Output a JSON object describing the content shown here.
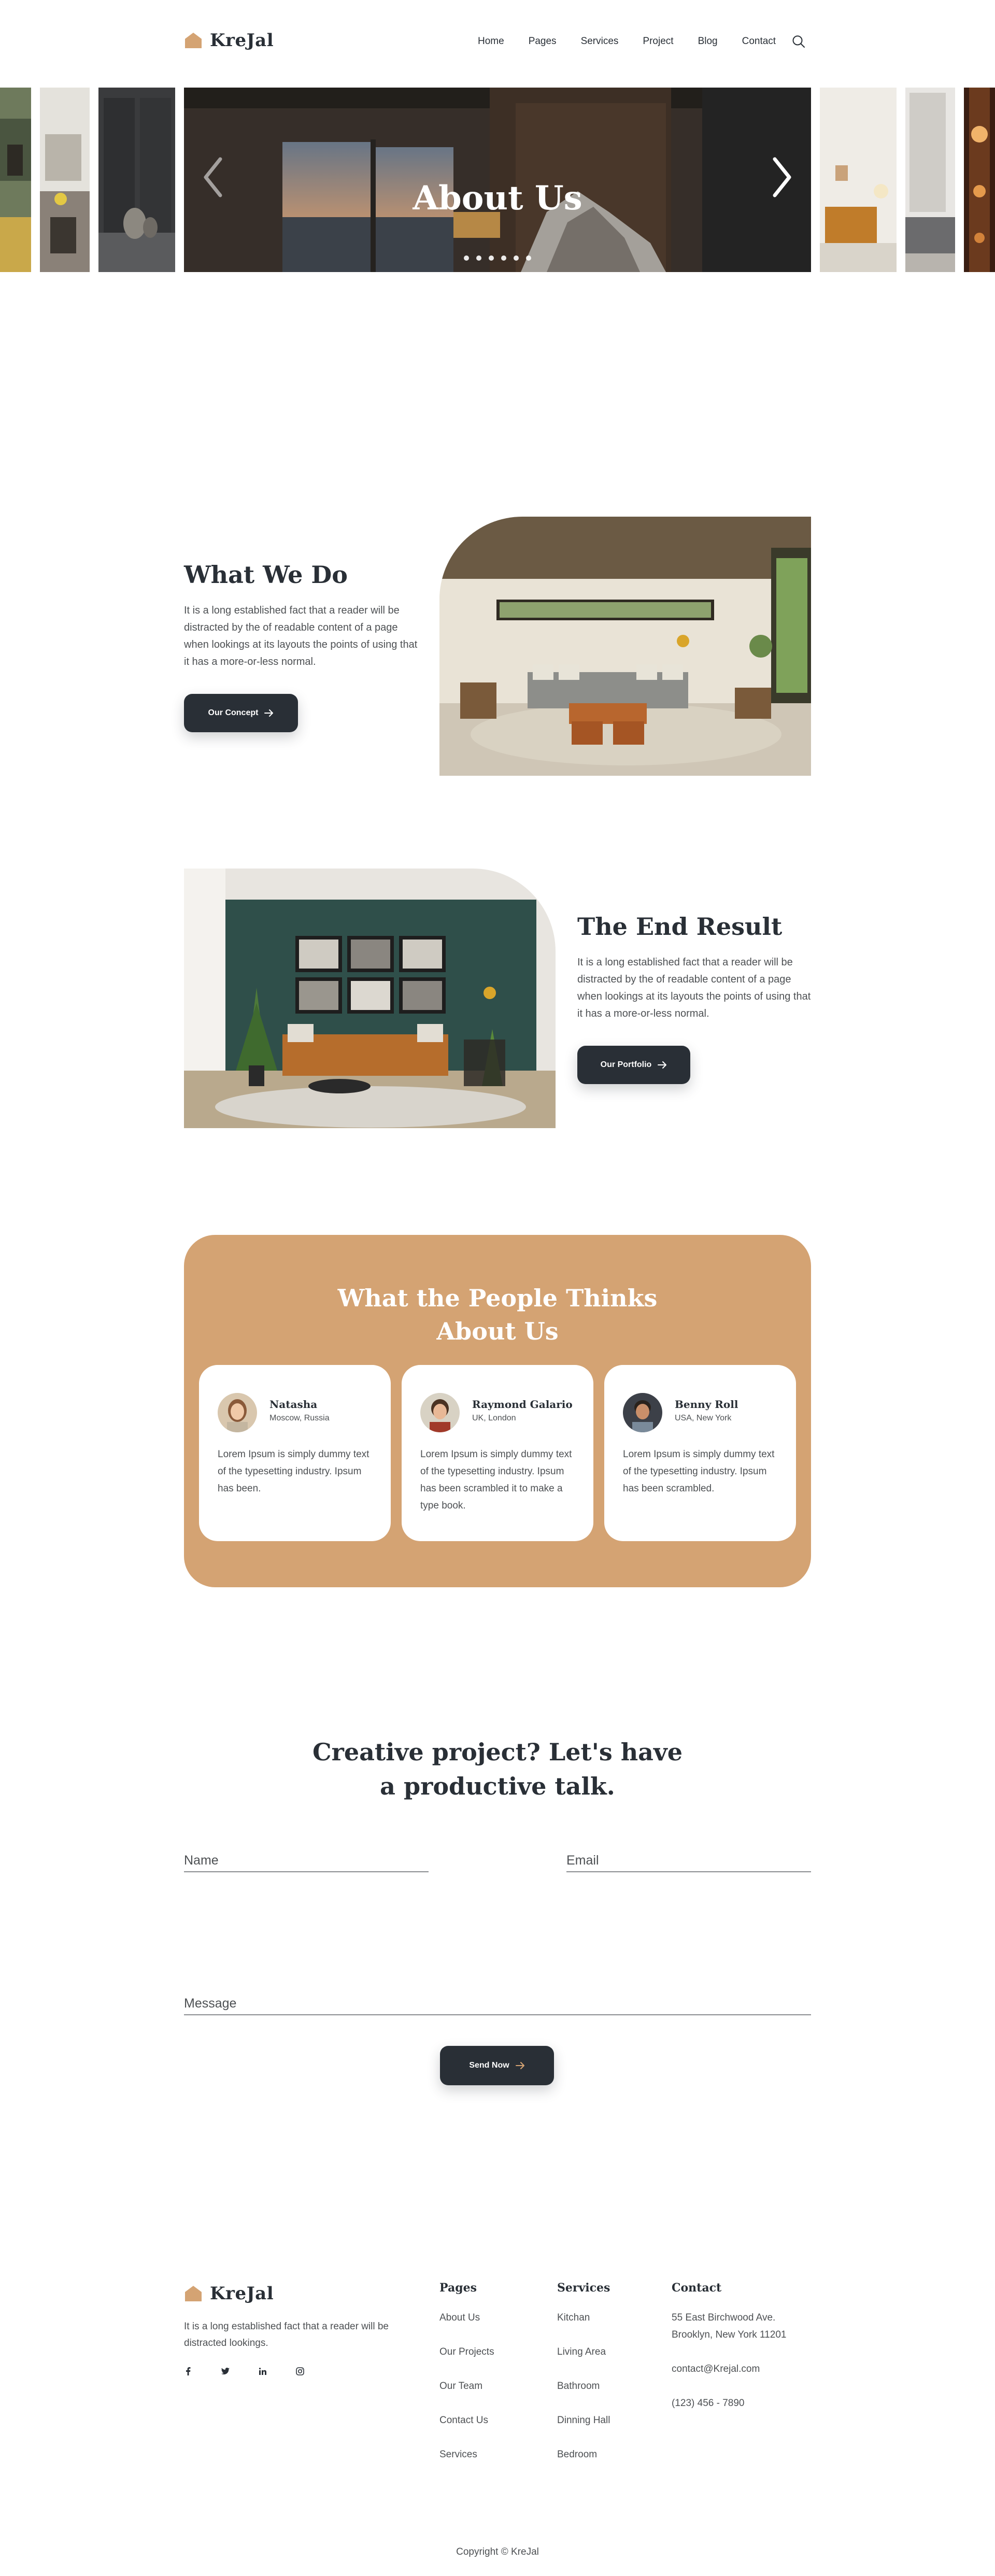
{
  "header": {
    "logo_text": "KreJal",
    "nav": [
      "Home",
      "Pages",
      "Services",
      "Project",
      "Blog",
      "Contact"
    ],
    "search_icon": "search-icon"
  },
  "slider": {
    "title": "About Us",
    "dot_count": 6,
    "prev_icon": "chevron-left-icon",
    "next_icon": "chevron-right-icon"
  },
  "what_we_do": {
    "title": "What We Do",
    "text": "It is a long established fact that a reader will be distracted by the of readable content of a page when lookings at its layouts the points of using that it has a more-or-less normal.",
    "button": "Our Concept"
  },
  "end_result": {
    "title": "The End Result",
    "text": "It is a long established fact that a reader will be distracted by the of readable content of a page when lookings at its layouts the points of using that it has a more-or-less normal.",
    "button": "Our Portfolio"
  },
  "testimonials": {
    "title_line1": "What the People Thinks",
    "title_line2": "About Us",
    "cards": [
      {
        "name": "Natasha",
        "location": "Moscow, Russia",
        "text": "Lorem Ipsum is simply dummy text of the typesetting industry. Ipsum has been."
      },
      {
        "name": "Raymond Galario",
        "location": "UK, London",
        "text": "Lorem Ipsum is simply dummy text of the typesetting industry. Ipsum has been scrambled it to make a type book."
      },
      {
        "name": "Benny Roll",
        "location": "USA, New York",
        "text": "Lorem Ipsum is simply dummy text of the typesetting industry. Ipsum has been scrambled."
      }
    ]
  },
  "contact": {
    "title_line1": "Creative project? Let's have",
    "title_line2": "a productive talk.",
    "name_placeholder": "Name",
    "email_placeholder": "Email",
    "message_placeholder": "Message",
    "button": "Send Now"
  },
  "footer": {
    "logo_text": "KreJal",
    "description": "It is a long established fact that a reader will be distracted lookings.",
    "socials": [
      "facebook-icon",
      "twitter-icon",
      "linkedin-icon",
      "instagram-icon"
    ],
    "pages_title": "Pages",
    "pages": [
      "About Us",
      "Our Projects",
      "Our Team",
      "Contact Us",
      "Services"
    ],
    "services_title": "Services",
    "services": [
      "Kitchan",
      "Living Area",
      "Bathroom",
      "Dinning Hall",
      "Bedroom"
    ],
    "contact_title": "Contact",
    "address_line1": "55 East Birchwood Ave.",
    "address_line2": "Brooklyn, New York 11201",
    "email": "contact@Krejal.com",
    "phone": "(123) 456 - 7890",
    "copyright": "Copyright © KreJal"
  },
  "colors": {
    "accent": "#d4a373",
    "dark": "#292f36",
    "text": "#4d5053"
  }
}
